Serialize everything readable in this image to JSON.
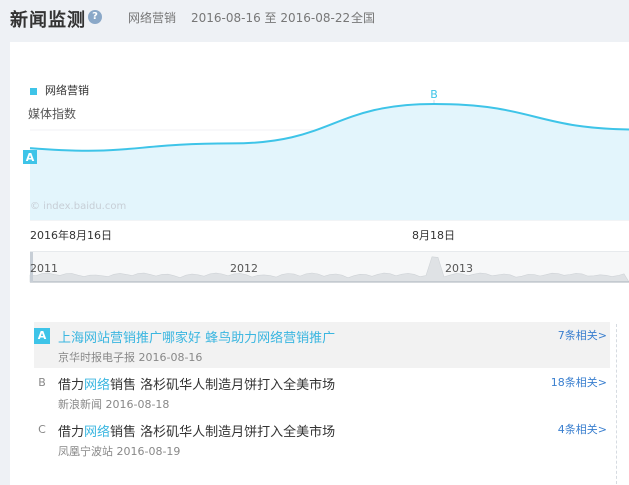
{
  "header": {
    "title": "新闻监测",
    "keyword": "网络营销",
    "date_range": "2016-08-16 至 2016-08-22",
    "region": "全国"
  },
  "chart_data": {
    "type": "area",
    "series": [
      {
        "name": "网络营销",
        "x": [
          "2016-08-16",
          "2016-08-17",
          "2016-08-18",
          "2016-08-19"
        ],
        "values": [
          0.62,
          0.66,
          1.0,
          0.78
        ]
      }
    ],
    "ylabel": "媒体指数",
    "xtick_labels": [
      "2016年8月16日",
      "8月18日"
    ],
    "markers": [
      {
        "label": "A",
        "x": "2016-08-16"
      },
      {
        "label": "B",
        "x": "2016-08-18"
      }
    ],
    "watermark": "© index.baidu.com",
    "overview_axis_labels": [
      "2011",
      "2012",
      "2013"
    ],
    "colors": {
      "line": "#3ec4e8",
      "fill": "#e3f5fc"
    }
  },
  "news": [
    {
      "badge": "A",
      "title_pre": "上海网站营销推广哪家好 蜂鸟助力网络营销推广",
      "keyword": "",
      "title_post": "",
      "source": "京华时报电子报 2016-08-16",
      "more": "7条相关>",
      "active": true
    },
    {
      "badge": "B",
      "title_pre": "借力",
      "keyword": "网络",
      "title_post": "销售 洛杉矶华人制造月饼打入全美市场",
      "source": "新浪新闻 2016-08-18",
      "more": "18条相关>",
      "active": false
    },
    {
      "badge": "C",
      "title_pre": "借力",
      "keyword": "网络",
      "title_post": "销售 洛杉矶华人制造月饼打入全美市场",
      "source": "凤凰宁波站 2016-08-19",
      "more": "4条相关>",
      "active": false
    }
  ]
}
